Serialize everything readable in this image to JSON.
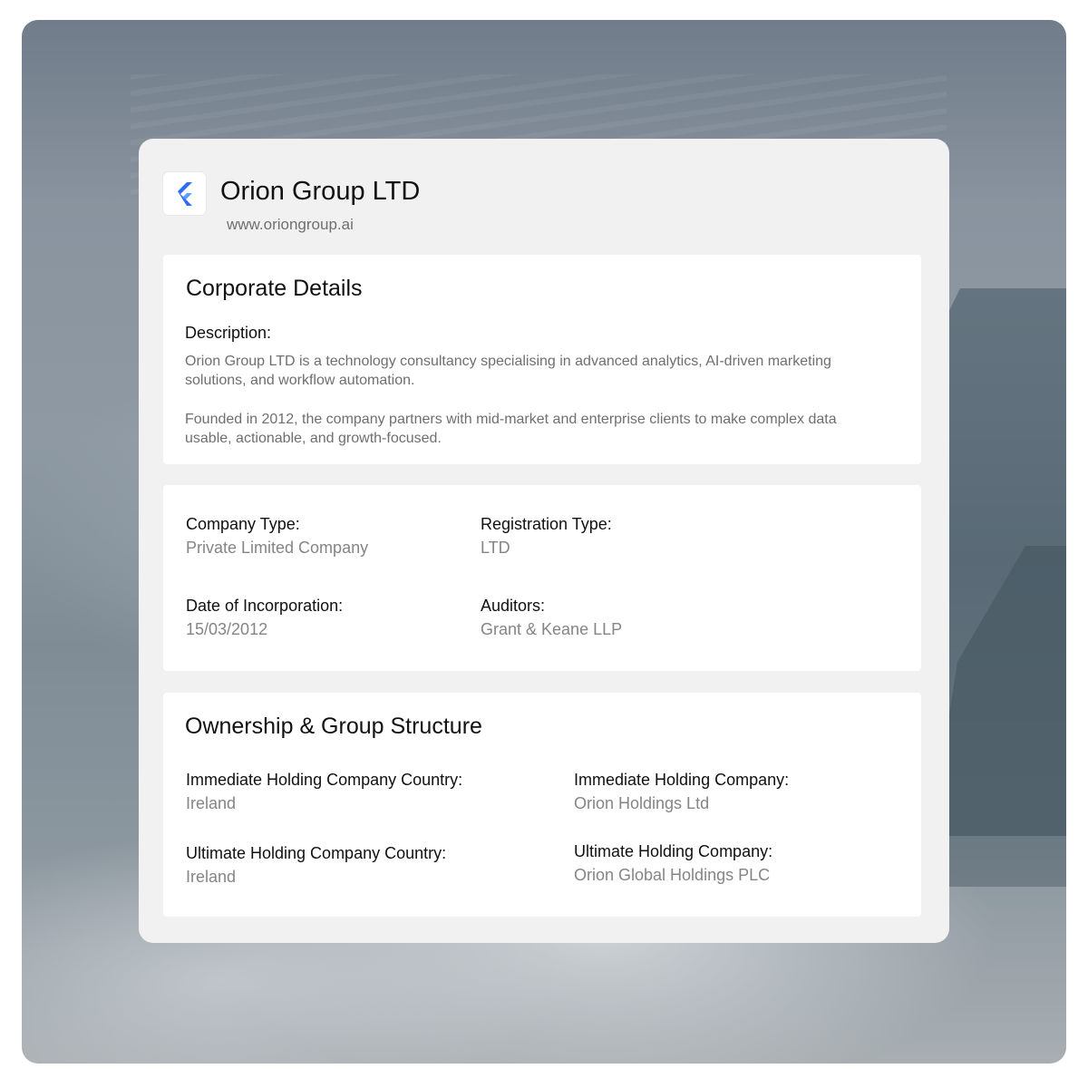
{
  "company": {
    "name": "Orion Group LTD",
    "website": "www.oriongroup.ai",
    "logo_icon": "flutter-chevron-logo-icon",
    "accent_color": "#2f6df6"
  },
  "corporate_details": {
    "title": "Corporate Details",
    "description_label": "Description:",
    "description_paragraph_1": "Orion Group LTD is a technology consultancy specialising in advanced analytics, AI-driven marketing solutions, and workflow automation.",
    "description_paragraph_2": "Founded in 2012, the company partners with mid-market and enterprise clients to make complex data usable, actionable, and growth-focused."
  },
  "registration": {
    "company_type_label": "Company Type:",
    "company_type_value": "Private Limited Company",
    "registration_type_label": "Registration Type:",
    "registration_type_value": "LTD",
    "incorporation_label": "Date of Incorporation:",
    "incorporation_value": "15/03/2012",
    "auditors_label": "Auditors:",
    "auditors_value": "Grant & Keane LLP"
  },
  "ownership": {
    "title": "Ownership & Group Structure",
    "immediate_country_label": "Immediate Holding Company Country:",
    "immediate_country_value": "Ireland",
    "immediate_company_label": "Immediate Holding Company:",
    "immediate_company_value": "Orion Holdings Ltd",
    "ultimate_country_label": "Ultimate Holding Company Country:",
    "ultimate_country_value": "Ireland",
    "ultimate_company_label": "Ultimate Holding Company:",
    "ultimate_company_value": "Orion Global Holdings PLC"
  }
}
